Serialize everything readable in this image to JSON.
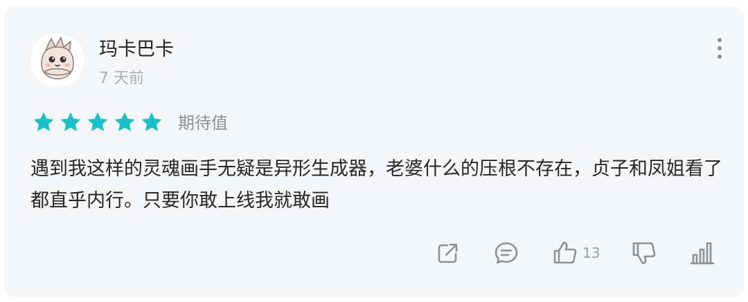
{
  "user": {
    "name": "玛卡巴卡",
    "time": "7 天前",
    "avatar_icon": "cartoon-conch-avatar"
  },
  "rating": {
    "stars": 5,
    "max_stars": 5,
    "label": "期待值",
    "star_color": "#19c0c8"
  },
  "review": {
    "text": "遇到我这样的灵魂画手无疑是异形生成器，老婆什么的压根不存在，贞子和凤姐看了都直乎内行。只要你敢上线我就敢画"
  },
  "actions": {
    "share_icon": "share-icon",
    "comment_icon": "comment-icon",
    "like_icon": "thumbs-up-icon",
    "like_count": "13",
    "dislike_icon": "thumbs-down-icon",
    "stats_icon": "bar-chart-icon"
  },
  "colors": {
    "card_bg": "#f5f6f8",
    "icon_gray": "#8c9096",
    "text_primary": "#262626",
    "text_secondary": "#a8acb2"
  }
}
